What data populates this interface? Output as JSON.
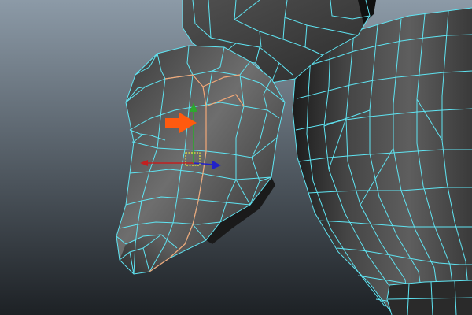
{
  "viewport": {
    "background_top": "#8c9aa7",
    "background_bottom": "#1d2125"
  },
  "colors": {
    "wireframe": "#5fe4f2",
    "selected_edge": "#f2a878",
    "annotation_arrow": "#ff5a0f",
    "axis_x": "#c22020",
    "axis_y": "#2ea82e",
    "axis_z": "#2222c8",
    "manipulator_center": "#e8e840",
    "mesh_light": "#7a7a7a",
    "mesh_dark": "#1e1e1e"
  },
  "icons": {
    "annotation": "orange-arrow-icon",
    "manipulator": "move-manipulator-icon"
  }
}
